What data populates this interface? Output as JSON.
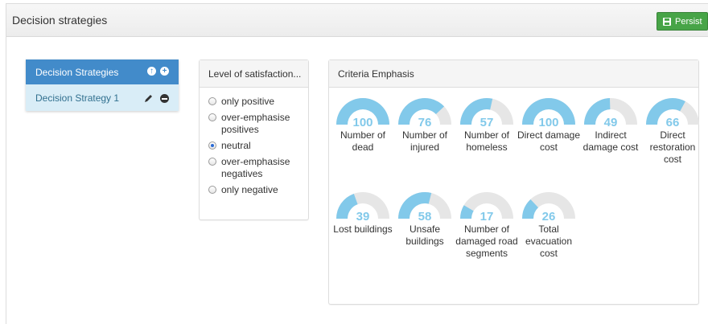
{
  "header": {
    "title": "Decision strategies",
    "persist_label": "Persist"
  },
  "strategies": {
    "title": "Decision Strategies",
    "items": [
      {
        "label": "Decision Strategy 1"
      }
    ]
  },
  "satisfaction": {
    "title": "Level of satisfaction...",
    "options": [
      {
        "label": "only positive",
        "checked": false
      },
      {
        "label": "over-emphasise positives",
        "checked": false
      },
      {
        "label": "neutral",
        "checked": true
      },
      {
        "label": "over-emphasise negatives",
        "checked": false
      },
      {
        "label": "only negative",
        "checked": false
      }
    ]
  },
  "criteria": {
    "title": "Criteria Emphasis",
    "max": 100,
    "fill_color": "#82c9ea",
    "track_color": "#e6e6e6",
    "value_color": "#82c9ea",
    "gauges": [
      {
        "value": 100,
        "label": "Number of dead"
      },
      {
        "value": 76,
        "label": "Number of injured"
      },
      {
        "value": 57,
        "label": "Number of homeless"
      },
      {
        "value": 100,
        "label": "Direct damage cost"
      },
      {
        "value": 49,
        "label": "Indirect damage cost"
      },
      {
        "value": 66,
        "label": "Direct restoration cost"
      },
      {
        "value": 39,
        "label": "Lost buildings"
      },
      {
        "value": 58,
        "label": "Unsafe buildings"
      },
      {
        "value": 17,
        "label": "Number of damaged road segments"
      },
      {
        "value": 26,
        "label": "Total evacuation cost"
      }
    ]
  }
}
